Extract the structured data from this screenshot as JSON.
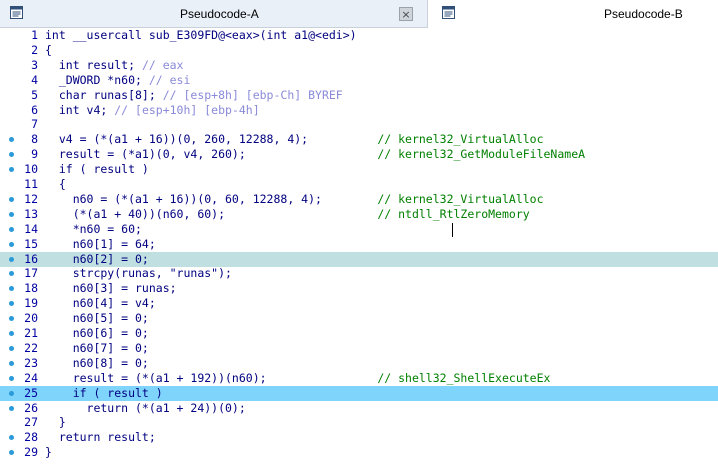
{
  "tabs": [
    {
      "label": "Pseudocode-A",
      "icon": "pseudocode-window-icon",
      "has_close": true,
      "close_glyph": "×"
    },
    {
      "label": "Pseudocode-B",
      "icon": "pseudocode-window-icon",
      "has_close": false
    }
  ],
  "colors": {
    "line_number": "#0000a0",
    "code": "#000080",
    "comment": "#008000",
    "stack_comment": "#8a8ad8",
    "highlight_soft": "#bfdfe0",
    "highlight_strong": "#7fd4fb",
    "breakpoint_dot": "#2a9ad8"
  },
  "lines": [
    {
      "n": "1",
      "dot": false,
      "code": "int __usercall sub_E309FD@<eax>(int a1@<edi>)",
      "comment": ""
    },
    {
      "n": "2",
      "dot": false,
      "code": "{",
      "comment": ""
    },
    {
      "n": "3",
      "dot": false,
      "code": "  int result; ",
      "comment": "// eax",
      "ctype": "gray"
    },
    {
      "n": "4",
      "dot": false,
      "code": "  _DWORD *n60; ",
      "comment": "// esi",
      "ctype": "gray"
    },
    {
      "n": "5",
      "dot": false,
      "code": "  char runas[8]; ",
      "comment": "// [esp+8h] [ebp-Ch] BYREF",
      "ctype": "gray"
    },
    {
      "n": "6",
      "dot": false,
      "code": "  int v4; ",
      "comment": "// [esp+10h] [ebp-4h]",
      "ctype": "gray"
    },
    {
      "n": "7",
      "dot": false,
      "code": "",
      "comment": ""
    },
    {
      "n": "8",
      "dot": true,
      "code": "  v4 = (*(a1 + 16))(0, 260, 12288, 4);          ",
      "comment": "// kernel32_VirtualAlloc",
      "ctype": "green"
    },
    {
      "n": "9",
      "dot": true,
      "code": "  result = (*a1)(0, v4, 260);                   ",
      "comment": "// kernel32_GetModuleFileNameA",
      "ctype": "green"
    },
    {
      "n": "10",
      "dot": true,
      "code": "  if ( result )",
      "comment": ""
    },
    {
      "n": "11",
      "dot": false,
      "code": "  {",
      "comment": ""
    },
    {
      "n": "12",
      "dot": true,
      "code": "    n60 = (*(a1 + 16))(0, 60, 12288, 4);        ",
      "comment": "// kernel32_VirtualAlloc",
      "ctype": "green"
    },
    {
      "n": "13",
      "dot": true,
      "code": "    (*(a1 + 40))(n60, 60);                      ",
      "comment": "// ntdll_RtlZeroMemory",
      "ctype": "green"
    },
    {
      "n": "14",
      "dot": true,
      "code": "    *n60 = 60;",
      "comment": ""
    },
    {
      "n": "15",
      "dot": true,
      "code": "    n60[1] = 64;",
      "comment": ""
    },
    {
      "n": "16",
      "dot": true,
      "code": "    n60[2] = 0;",
      "comment": "",
      "hl": "soft"
    },
    {
      "n": "17",
      "dot": true,
      "code": "    strcpy(runas, \"runas\");",
      "comment": ""
    },
    {
      "n": "18",
      "dot": true,
      "code": "    n60[3] = runas;",
      "comment": ""
    },
    {
      "n": "19",
      "dot": true,
      "code": "    n60[4] = v4;",
      "comment": ""
    },
    {
      "n": "20",
      "dot": true,
      "code": "    n60[5] = 0;",
      "comment": ""
    },
    {
      "n": "21",
      "dot": true,
      "code": "    n60[6] = 0;",
      "comment": ""
    },
    {
      "n": "22",
      "dot": true,
      "code": "    n60[7] = 0;",
      "comment": ""
    },
    {
      "n": "23",
      "dot": true,
      "code": "    n60[8] = 0;",
      "comment": ""
    },
    {
      "n": "24",
      "dot": true,
      "code": "    result = (*(a1 + 192))(n60);                ",
      "comment": "// shell32_ShellExecuteEx",
      "ctype": "green"
    },
    {
      "n": "25",
      "dot": true,
      "code": "    if ( result )",
      "comment": "",
      "hl": "strong"
    },
    {
      "n": "26",
      "dot": true,
      "code": "      return (*(a1 + 24))(0);",
      "comment": ""
    },
    {
      "n": "27",
      "dot": false,
      "code": "  }",
      "comment": ""
    },
    {
      "n": "28",
      "dot": true,
      "code": "  return result;",
      "comment": ""
    },
    {
      "n": "29",
      "dot": true,
      "code": "}",
      "comment": ""
    }
  ]
}
